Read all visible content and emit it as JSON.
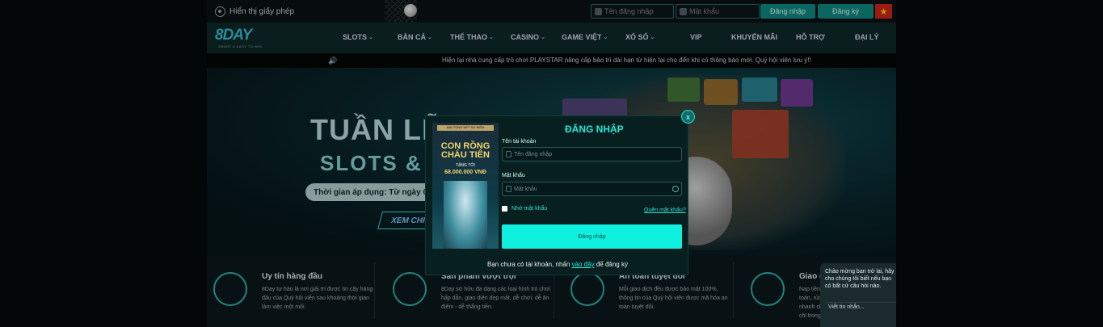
{
  "topbar": {
    "license": "Hiển thị giấy phép",
    "username_placeholder": "Tên đăng nhập",
    "password_placeholder": "Mật khẩu",
    "login_btn": "Đăng nhập",
    "register_btn": "Đăng ký",
    "flag": "★"
  },
  "logo": {
    "text": "8DAY",
    "slogan": "SMART & EASY TO WIN"
  },
  "nav": [
    {
      "label": "SLOTS",
      "chev": true
    },
    {
      "label": "BẮN CÁ",
      "chev": true
    },
    {
      "label": "THỂ THAO",
      "chev": true
    },
    {
      "label": "CASINO",
      "chev": true
    },
    {
      "label": "GAME VIỆT",
      "chev": true
    },
    {
      "label": "XỔ SỐ",
      "chev": true
    },
    {
      "label": "VIP",
      "chev": false
    },
    {
      "label": "KHUYẾN MÃI",
      "chev": false
    },
    {
      "label": "HỖ TRỢ",
      "chev": false
    },
    {
      "label": "ĐẠI LÝ",
      "chev": false
    }
  ],
  "ticker": {
    "icon": "speaker-icon",
    "text": "Hiện tại nhà cung cấp trò chơi PLAYSTAR nâng cấp bảo trì dài hạn từ hiện tại cho đến khi có thông báo mới. Quý hội viên lưu ý!!"
  },
  "banner": {
    "title": "TUẦN LỄ",
    "sub": "SLOTS & ",
    "time": "Thời gian áp dụng: Từ ngày 0",
    "more": "XEM CHI"
  },
  "features": [
    {
      "title": "Uy tín hàng đầu",
      "desc": "8Day tự hào là nơi giải trí được tin cậy hàng đầu của Quý hội viên sau khoảng thời gian làm việc một mối."
    },
    {
      "title": "Sản phẩm vượt trội",
      "desc": "8Day sở hữu đa dạng các loại hình trò chơi hấp dẫn, giao diện đẹp mắt, dễ chơi, dễ ăn điểm - dễ thắng tiền."
    },
    {
      "title": "An toàn tuyệt đối",
      "desc": "Mỗi giao dịch đều được bảo mật 100%, thông tin của Quý hội viên được mã hóa an toàn tuyệt đối."
    },
    {
      "title": "Giao d",
      "desc": "Nạp tiền thanh toán, rút tiền nhanh chóng chỉ trong vòng"
    }
  ],
  "modal": {
    "title": "ĐĂNG NHẬP",
    "close": "x",
    "promo_cap": "ĐẠI TỔNG KẾT SỰ KIỆN",
    "promo_t1": "CON RỒNG CHÁU TIÊN",
    "promo_t2": "TẶNG TỚI",
    "promo_t3": "68.000.000 VNĐ",
    "user_label": "Tên tài khoản",
    "user_placeholder": "Tên đăng nhập",
    "pass_label": "Mật khẩu",
    "pass_placeholder": "Mật khẩu",
    "remember": "Nhớ mật khẩu",
    "forgot": "Quên mật khẩu?",
    "submit": "Đăng nhập",
    "foot_pre": "Bạn chưa có tài khoản, nhấn ",
    "foot_link": "vào đây",
    "foot_post": " để đăng ký"
  },
  "chat": {
    "greeting": "Chào mừng bạn trở lại, hãy cho chúng tôi biết nếu bạn có bất cứ câu hỏi nào.",
    "placeholder": "Viết tin nhắn..."
  }
}
